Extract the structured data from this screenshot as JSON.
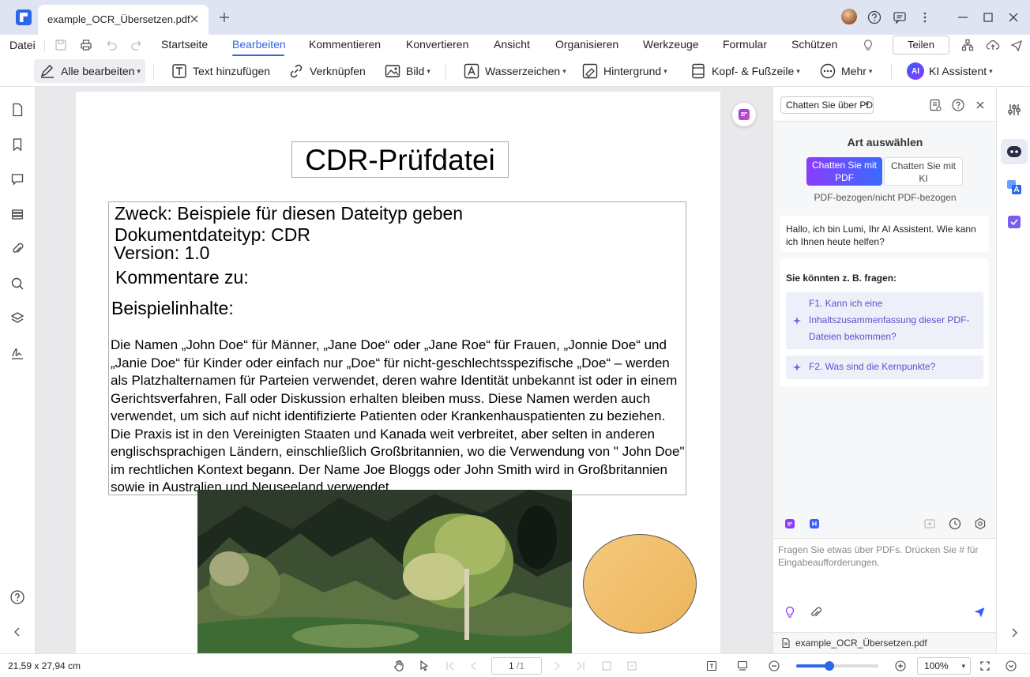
{
  "titlebar": {
    "tab_title": "example_OCR_Übersetzen.pdf"
  },
  "menu": {
    "file": "Datei",
    "tabs": [
      "Startseite",
      "Bearbeiten",
      "Kommentieren",
      "Konvertieren",
      "Ansicht",
      "Organisieren",
      "Werkzeuge",
      "Formular",
      "Schützen"
    ],
    "active_tab": "Bearbeiten",
    "share": "Teilen"
  },
  "toolbar": {
    "edit_all": "Alle bearbeiten",
    "add_text": "Text hinzufügen",
    "link": "Verknüpfen",
    "image": "Bild",
    "watermark": "Wasserzeichen",
    "background": "Hintergrund",
    "header_footer": "Kopf- & Fußzeile",
    "more": "Mehr",
    "ai_badge": "AI",
    "ai_assistant": "KI Assistent"
  },
  "document": {
    "title": "CDR-Prüfdatei",
    "purpose": "Zweck: Beispiele für diesen Dateityp geben",
    "doc_type": "Dokumentdateityp: CDR",
    "version": "Version: 1.0",
    "comments": "Kommentare zu:",
    "sample_heading": "Beispielinhalte:",
    "paragraph": "Die Namen „John Doe“ für Männer, „Jane Doe“ oder „Jane Roe“ für Frauen, „Jonnie Doe“ und „Janie Doe“ für Kinder oder einfach nur „Doe“ für nicht-geschlechtsspezifische „Doe“ – werden als Platzhalternamen für Parteien verwendet, deren wahre Identität unbekannt ist oder in einem Gerichtsverfahren, Fall oder Diskussion erhalten bleiben muss. Diese Namen werden auch verwendet, um sich auf nicht identifizierte Patienten oder Krankenhauspatienten zu beziehen. Die Praxis ist in den Vereinigten Staaten und Kanada weit verbreitet, aber selten in anderen englischsprachigen Ländern, einschließlich Großbritannien, wo die Verwendung von \" John Doe\" im rechtlichen Kontext begann. Der Name Joe Bloggs oder John Smith wird in Großbritannien sowie in Australien und Neuseeland verwendet."
  },
  "chat": {
    "mode_select": "Chatten Sie über PDF",
    "select_type_title": "Art auswählen",
    "chat_pdf_line1": "Chatten Sie mit",
    "chat_pdf_line2": "PDF",
    "chat_ki_line1": "Chatten Sie mit",
    "chat_ki_line2": "KI",
    "select_type_sub": "PDF-bezogen/nicht PDF-bezogen",
    "greeting": "Hallo, ich bin Lumi, Ihr AI Assistent. Wie kann ich Ihnen heute helfen?",
    "suggest_title": "Sie könnten z. B. fragen:",
    "suggestions": [
      "F1. Kann ich eine Inhaltszusammenfassung dieser PDF-Dateien bekommen?",
      "F2. Was sind die Kernpunkte?"
    ],
    "input_placeholder": "Fragen Sie etwas über PDFs. Drücken Sie # für Eingabeaufforderungen.",
    "attached_file": "example_OCR_Übersetzen.pdf"
  },
  "status": {
    "page_size": "21,59 x 27,94 cm",
    "current_page": "1",
    "total_pages": "/1",
    "zoom": "100%",
    "zoom_fraction": 0.4
  },
  "colors": {
    "accent": "#2d66e6",
    "ai_purple": "#8a3cff",
    "titlebar": "#dfe4f2",
    "canvas": "#e9e9ec"
  }
}
